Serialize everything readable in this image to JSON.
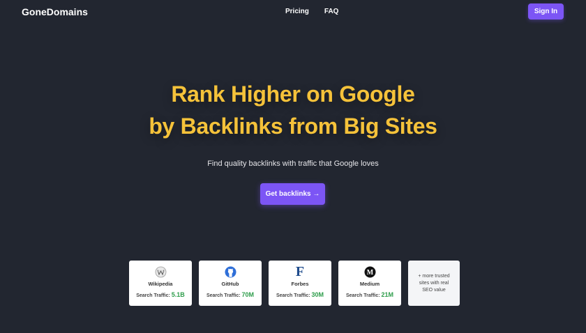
{
  "brand": {
    "name": "GoneDomains"
  },
  "nav": {
    "links": [
      "Pricing",
      "FAQ"
    ],
    "signin_label": "Sign In"
  },
  "hero": {
    "headline_line1": "Rank Higher on Google",
    "headline_line2": "by Backlinks from Big Sites",
    "subtitle": "Find quality backlinks with traffic that Google loves",
    "cta_label": "Get backlinks →"
  },
  "colors": {
    "background": "#222630",
    "accent": "#7c55f5",
    "headline": "#f5c23a",
    "traffic": "#2e9d4b"
  },
  "sites": [
    {
      "name": "Wikipedia",
      "traffic_label": "Search Traffic:",
      "traffic_value": "5.1B",
      "icon": "wikipedia-icon"
    },
    {
      "name": "GitHub",
      "traffic_label": "Search Traffic:",
      "traffic_value": "70M",
      "icon": "github-icon"
    },
    {
      "name": "Forbes",
      "traffic_label": "Search Traffic:",
      "traffic_value": "30M",
      "icon": "forbes-icon"
    },
    {
      "name": "Medium",
      "traffic_label": "Search Traffic:",
      "traffic_value": "21M",
      "icon": "medium-icon"
    }
  ],
  "more_sites": {
    "line1": "+ more trusted",
    "line2": "sites with real",
    "line3": "SEO value"
  }
}
